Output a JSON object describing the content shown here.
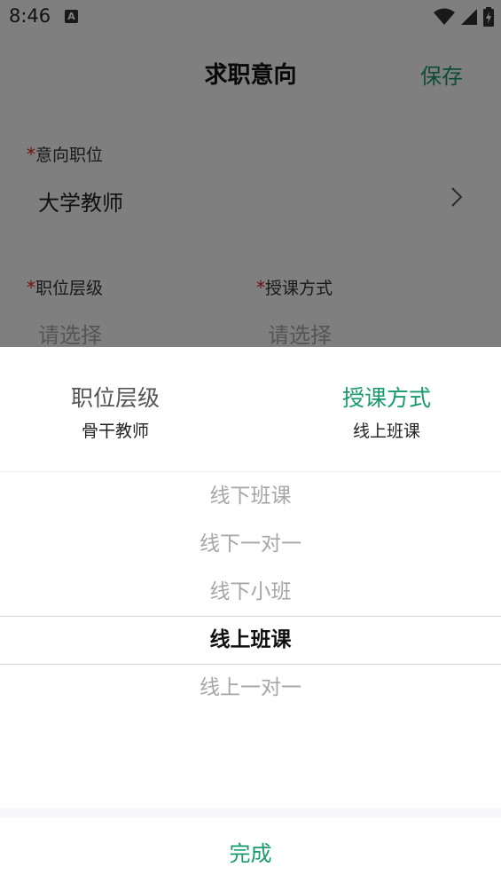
{
  "status_bar": {
    "time": "8:46",
    "a_icon": "A"
  },
  "nav": {
    "title": "求职意向",
    "save_label": "保存"
  },
  "form": {
    "required_mark": "*",
    "position": {
      "label": "意向职位",
      "value": "大学教师"
    },
    "level": {
      "label": "职位层级",
      "placeholder": "请选择"
    },
    "method": {
      "label": "授课方式",
      "placeholder": "请选择"
    }
  },
  "picker": {
    "tabs": [
      {
        "title": "职位层级",
        "selected": "骨干教师",
        "active": false
      },
      {
        "title": "授课方式",
        "selected": "线上班课",
        "active": true
      }
    ],
    "options": [
      "线下班课",
      "线下一对一",
      "线下小班",
      "线上班课",
      "线上一对一"
    ],
    "selected_index": 3,
    "done_label": "完成"
  },
  "colors": {
    "accent": "#1a9b6c",
    "required": "#e02020"
  }
}
